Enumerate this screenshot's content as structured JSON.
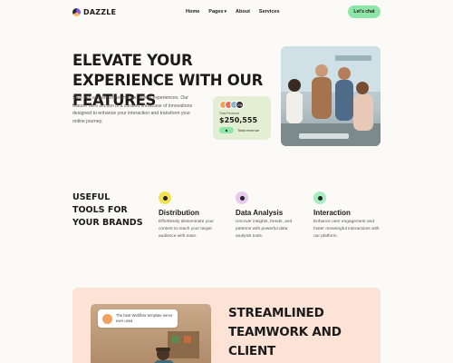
{
  "nav": {
    "logo_text": "DAZZLE",
    "links": [
      "Home",
      "Pages",
      "About",
      "Services"
    ],
    "cta": "Let's chat"
  },
  "hero": {
    "title": "ELEVATE YOUR EXPERIENCE WITH OUR FEATURES",
    "description": "Step into a realm of heightened digital experiences. Our feature hero section is a curated showcase of innovations designed to enhance your interaction and transform your online journey.",
    "stat_card": {
      "badge": "20k",
      "small_label": "Total Revenue",
      "amount": "$250,555",
      "btn_icon": "■",
      "label": "Total revenue"
    }
  },
  "features": {
    "title": "USEFUL TOOLS FOR YOUR BRANDS",
    "items": [
      {
        "name": "Distribution",
        "desc": "Effortlessly disseminate your content to reach your target audience with ease.",
        "color": "#f2e14f"
      },
      {
        "name": "Data Analysis",
        "desc": "Uncover insights, trends, and patterns with powerful data analysis tools.",
        "color": "#e7c9f0"
      },
      {
        "name": "Interaction",
        "desc": "Enhance user engagement and foster meaningful interactions with our platform.",
        "color": "#a8ecc0"
      }
    ]
  },
  "bottom": {
    "review": "The best Webflow template we've ever used",
    "title": "STREAMLINED TEAMWORK AND CLIENT ENGAGEMENT"
  }
}
